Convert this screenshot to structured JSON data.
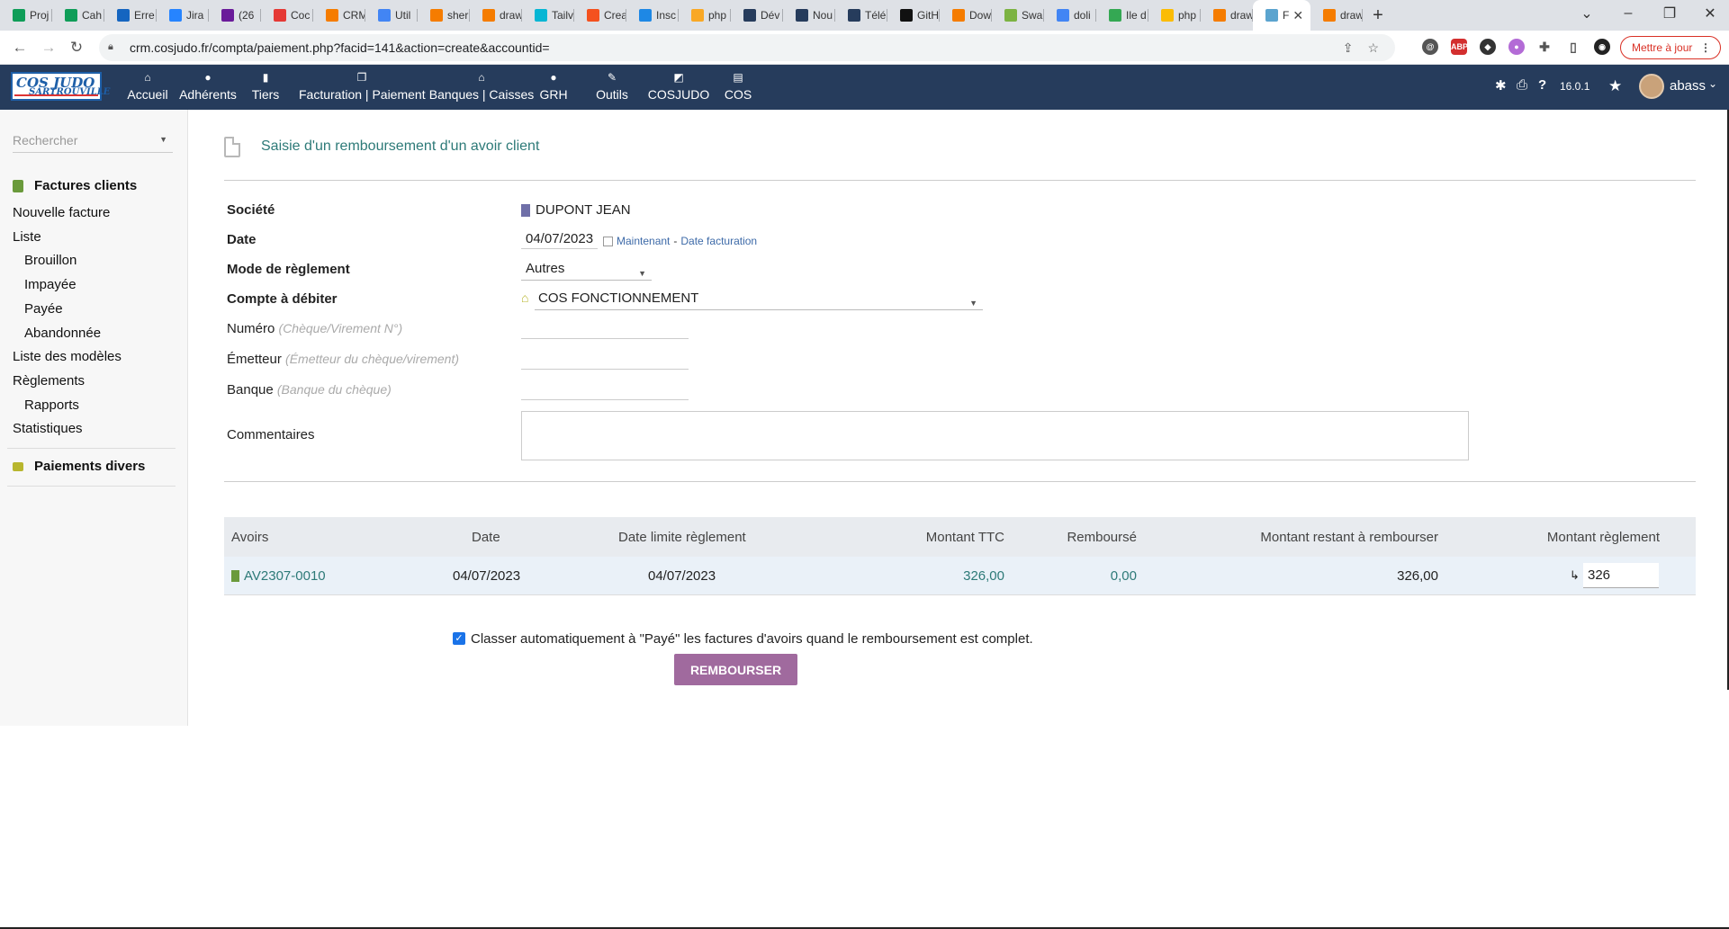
{
  "browser": {
    "tabs": [
      {
        "label": "Proj",
        "color": "#0f9d58"
      },
      {
        "label": "Cah",
        "color": "#0f9d58"
      },
      {
        "label": "Erre",
        "color": "#1565c0"
      },
      {
        "label": "Jira",
        "color": "#2684ff"
      },
      {
        "label": "(26",
        "color": "#6a1b9a"
      },
      {
        "label": "Coc",
        "color": "#e53935"
      },
      {
        "label": "CRM",
        "color": "#f57c00"
      },
      {
        "label": "Util",
        "color": "#4285f4"
      },
      {
        "label": "sher",
        "color": "#f57c00"
      },
      {
        "label": "draw",
        "color": "#f57c00"
      },
      {
        "label": "Tailv",
        "color": "#06b6d4"
      },
      {
        "label": "Crea",
        "color": "#f4511e"
      },
      {
        "label": "Insc",
        "color": "#1e88e5"
      },
      {
        "label": "php",
        "color": "#f9a825"
      },
      {
        "label": "Dév",
        "color": "#263c5c"
      },
      {
        "label": "Nou",
        "color": "#263c5c"
      },
      {
        "label": "Télé",
        "color": "#263c5c"
      },
      {
        "label": "GitH",
        "color": "#111111"
      },
      {
        "label": "Dow",
        "color": "#f57c00"
      },
      {
        "label": "Swa",
        "color": "#7cb342"
      },
      {
        "label": "doli",
        "color": "#4285f4"
      },
      {
        "label": "Ile d",
        "color": "#34a853"
      },
      {
        "label": "php",
        "color": "#fbbc04"
      },
      {
        "label": "draw",
        "color": "#f57c00"
      },
      {
        "label": "F",
        "color": "#5ba4cf",
        "active": true
      },
      {
        "label": "draw",
        "color": "#f57c00"
      }
    ],
    "new_tab": "+",
    "url": "crm.cosjudo.fr/compta/paiement.php?facid=141&action=create&accountid=",
    "update_button": "Mettre à jour"
  },
  "app": {
    "logo": {
      "line1": "COS JUDO",
      "line2": "SARTROUVILLE"
    },
    "menu": [
      {
        "label": "Accueil",
        "icon": "home-icon",
        "glyph": "⌂"
      },
      {
        "label": "Adhérents",
        "icon": "user-icon",
        "glyph": "●"
      },
      {
        "label": "Tiers",
        "icon": "building-icon",
        "glyph": "▮"
      },
      {
        "label": "Facturation | Paiement",
        "icon": "invoice-icon",
        "glyph": "❐"
      },
      {
        "label": "Banques | Caisses",
        "icon": "bank-icon",
        "glyph": "⌂"
      },
      {
        "label": "GRH",
        "icon": "user-tie-icon",
        "glyph": "●"
      },
      {
        "label": "Outils",
        "icon": "wrench-icon",
        "glyph": "✎"
      },
      {
        "label": "COSJUDO",
        "icon": "external-icon",
        "glyph": "◩"
      },
      {
        "label": "COS",
        "icon": "note-icon",
        "glyph": "▤"
      }
    ],
    "version": "16.0.1",
    "user": "abass"
  },
  "sidebar": {
    "search_placeholder": "Rechercher",
    "section1": "Factures clients",
    "items": [
      {
        "label": "Nouvelle facture",
        "indent": false
      },
      {
        "label": "Liste",
        "indent": false
      },
      {
        "label": "Brouillon",
        "indent": true
      },
      {
        "label": "Impayée",
        "indent": true
      },
      {
        "label": "Payée",
        "indent": true
      },
      {
        "label": "Abandonnée",
        "indent": true
      },
      {
        "label": "Liste des modèles",
        "indent": false
      },
      {
        "label": "Règlements",
        "indent": false
      },
      {
        "label": "Rapports",
        "indent": true
      },
      {
        "label": "Statistiques",
        "indent": false
      }
    ],
    "section2": "Paiements divers"
  },
  "page": {
    "title": "Saisie d'un remboursement d'un avoir client",
    "fields": {
      "societe_label": "Société",
      "societe_value": "DUPONT JEAN",
      "date_label": "Date",
      "date_value": "04/07/2023",
      "now_link": "Maintenant",
      "date_sep": "-",
      "invoice_date_link": "Date facturation",
      "mode_label": "Mode de règlement",
      "mode_value": "Autres",
      "compte_label": "Compte à débiter",
      "compte_value": "COS FONCTIONNEMENT",
      "numero_label": "Numéro",
      "numero_hint": "(Chèque/Virement N°)",
      "emetteur_label": "Émetteur",
      "emetteur_hint": "(Émetteur du chèque/virement)",
      "banque_label": "Banque",
      "banque_hint": "(Banque du chèque)",
      "commentaires_label": "Commentaires"
    },
    "table": {
      "headers": [
        "Avoirs",
        "Date",
        "Date limite règlement",
        "Montant TTC",
        "Remboursé",
        "Montant restant à rembourser",
        "Montant règlement"
      ],
      "row": {
        "ref": "AV2307-0010",
        "date": "04/07/2023",
        "due_date": "04/07/2023",
        "ttc": "326,00",
        "rembourse": "0,00",
        "restant": "326,00",
        "arrow": "↳",
        "montant": "326"
      }
    },
    "auto_classify_label": "Classer automatiquement à \"Payé\" les factures d'avoirs quand le remboursement est complet.",
    "submit": "REMBOURSER"
  }
}
